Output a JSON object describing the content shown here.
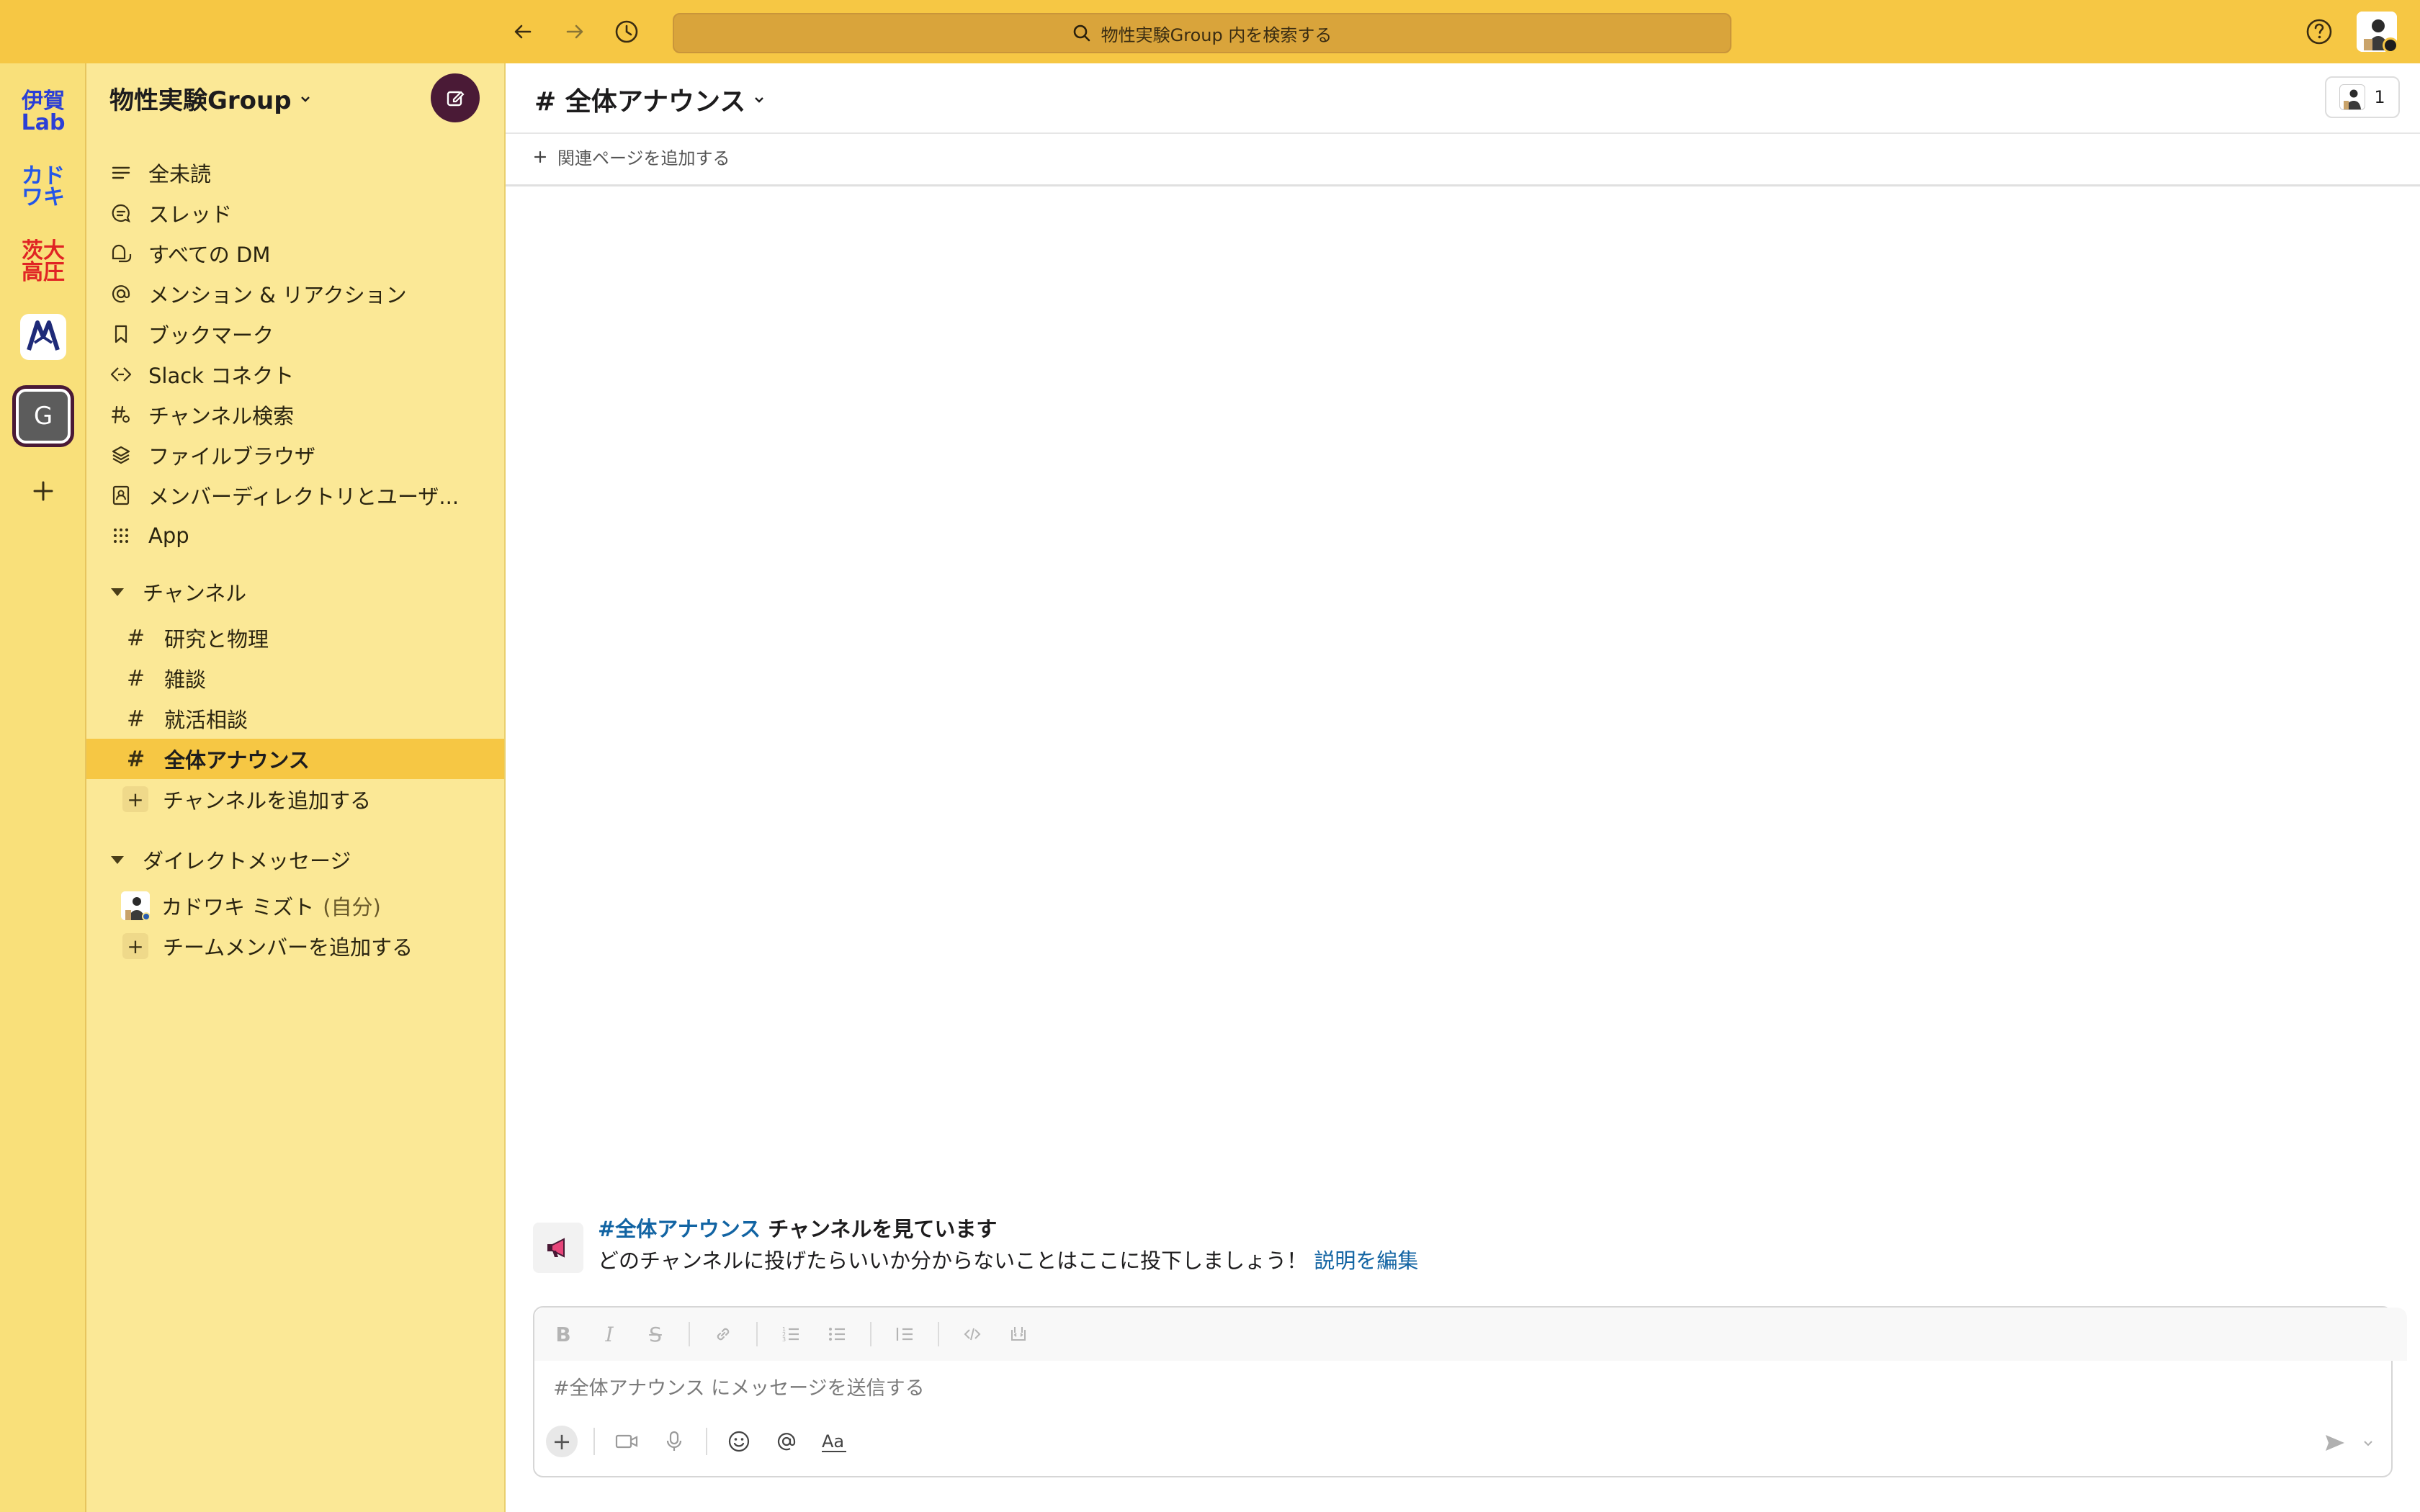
{
  "topbar": {
    "search_placeholder": "物性実験Group 内を検索する"
  },
  "rail": {
    "workspaces": [
      {
        "label": "伊賀\nLab",
        "color": "#2b3fd6"
      },
      {
        "label": "カド\nワキ",
        "color": "#2456e8"
      },
      {
        "label": "茨大\n高圧",
        "color": "#e02424"
      },
      {
        "label": "",
        "icon": "crest-icon"
      },
      {
        "label": "G",
        "active": true
      }
    ]
  },
  "sidebar": {
    "workspace_name": "物性実験Group",
    "nav": [
      {
        "label": "全未読",
        "icon": "all-unreads-icon"
      },
      {
        "label": "スレッド",
        "icon": "threads-icon"
      },
      {
        "label": "すべての DM",
        "icon": "dm-icon"
      },
      {
        "label": "メンション & リアクション",
        "icon": "mention-icon"
      },
      {
        "label": "ブックマーク",
        "icon": "bookmark-icon"
      },
      {
        "label": "Slack コネクト",
        "icon": "connect-icon"
      },
      {
        "label": "チャンネル検索",
        "icon": "channel-search-icon"
      },
      {
        "label": "ファイルブラウザ",
        "icon": "files-icon"
      },
      {
        "label": "メンバーディレクトリとユーザ...",
        "icon": "directory-icon"
      },
      {
        "label": "App",
        "icon": "apps-icon"
      }
    ],
    "channels_header": "チャンネル",
    "channels": [
      "研究と物理",
      "雑談",
      "就活相談",
      "全体アナウンス"
    ],
    "active_channel_index": 3,
    "add_channel": "チャンネルを追加する",
    "dm_header": "ダイレクトメッセージ",
    "dm_user": "カドワキ ミズト",
    "dm_self_tag": "(自分)",
    "add_member": "チームメンバーを追加する"
  },
  "main": {
    "channel_title": "# 全体アナウンス",
    "member_count": "1",
    "add_bookmark": "関連ページを追加する",
    "intro_channel": "#全体アナウンス",
    "intro_title_rest": " チャンネルを見ています",
    "intro_desc": "どのチャンネルに投げたらいいか分からないことはここに投下しましょう！ ",
    "intro_edit": "説明を編集",
    "composer_placeholder": "#全体アナウンス にメッセージを送信する"
  },
  "colors": {
    "topbar": "#f6c744",
    "sidebar": "#fbe896",
    "active_channel": "#f6c744",
    "compose_button": "#4a1a36",
    "link": "#1264a3"
  }
}
